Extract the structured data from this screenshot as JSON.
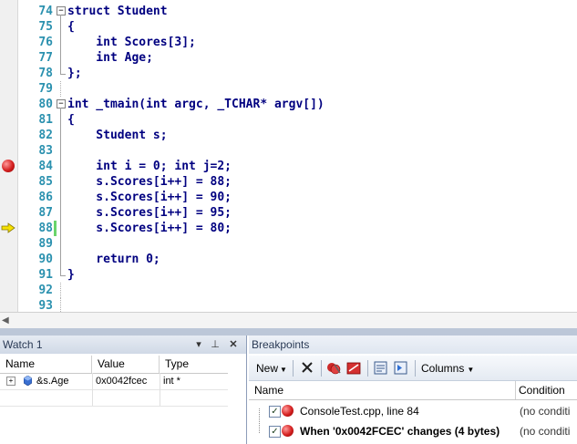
{
  "editor": {
    "lines": [
      {
        "num": "74",
        "code": "struct Student"
      },
      {
        "num": "75",
        "code": "{"
      },
      {
        "num": "76",
        "code": "    int Scores[3];"
      },
      {
        "num": "77",
        "code": "    int Age;"
      },
      {
        "num": "78",
        "code": "};"
      },
      {
        "num": "79",
        "code": ""
      },
      {
        "num": "80",
        "code": "int _tmain(int argc, _TCHAR* argv[])"
      },
      {
        "num": "81",
        "code": "{"
      },
      {
        "num": "82",
        "code": "    Student s;"
      },
      {
        "num": "83",
        "code": ""
      },
      {
        "num": "84",
        "code": "    int i = 0; int j=2;"
      },
      {
        "num": "85",
        "code": "    s.Scores[i++] = 88;"
      },
      {
        "num": "86",
        "code": "    s.Scores[i++] = 90;"
      },
      {
        "num": "87",
        "code": "    s.Scores[i++] = 95;"
      },
      {
        "num": "88",
        "code": "    s.Scores[i++] = 80;"
      },
      {
        "num": "89",
        "code": ""
      },
      {
        "num": "90",
        "code": "    return 0;"
      },
      {
        "num": "91",
        "code": "}"
      },
      {
        "num": "92",
        "code": ""
      },
      {
        "num": "93",
        "code": ""
      }
    ],
    "breakpoint_line": "84",
    "current_line": "88"
  },
  "watch": {
    "title": "Watch 1",
    "columns": [
      "Name",
      "Value",
      "Type"
    ],
    "rows": [
      {
        "name": "&s.Age",
        "value": "0x0042fcec",
        "type": "int *"
      }
    ]
  },
  "breakpoints": {
    "title": "Breakpoints",
    "toolbar": {
      "new": "New",
      "columns": "Columns"
    },
    "columns": [
      "Name",
      "Condition"
    ],
    "rows": [
      {
        "name": "ConsoleTest.cpp, line 84",
        "condition": "(no conditi",
        "bold": false,
        "checked": true
      },
      {
        "name": "When '0x0042FCEC' changes (4 bytes)",
        "condition": "(no conditi",
        "bold": true,
        "checked": true
      }
    ]
  },
  "colors": {
    "keyword": "#000080",
    "line_number": "#2b91af",
    "breakpoint": "#d42020",
    "arrow": "#f5e000"
  }
}
